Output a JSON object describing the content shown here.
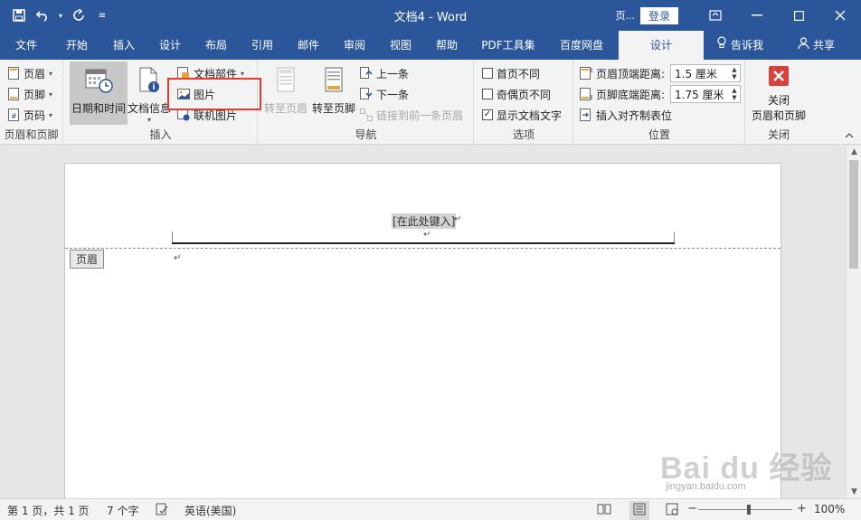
{
  "titlebar": {
    "title": "文档4 - Word",
    "tag": "页...",
    "login_label": "登录"
  },
  "tabs": [
    {
      "label": "文件"
    },
    {
      "label": "开始"
    },
    {
      "label": "插入"
    },
    {
      "label": "设计"
    },
    {
      "label": "布局"
    },
    {
      "label": "引用"
    },
    {
      "label": "邮件"
    },
    {
      "label": "审阅"
    },
    {
      "label": "视图"
    },
    {
      "label": "帮助"
    },
    {
      "label": "PDF工具集"
    },
    {
      "label": "百度网盘"
    },
    {
      "label": "设计"
    }
  ],
  "tell_me": "告诉我",
  "share": "共享",
  "ribbon": {
    "hf_group": {
      "label": "页眉和页脚",
      "header": "页眉",
      "footer": "页脚",
      "page_number": "页码"
    },
    "insert_group": {
      "label": "插入",
      "date_time": "日期和时间",
      "doc_info": "文档信息",
      "quick_parts": "文档部件",
      "pictures": "图片",
      "online_pictures": "联机图片"
    },
    "nav_group": {
      "label": "导航",
      "goto_header": "转至页眉",
      "goto_footer": "转至页脚",
      "previous": "上一条",
      "next": "下一条",
      "link_previous": "链接到前一条页眉"
    },
    "options_group": {
      "label": "选项",
      "different_first": "首页不同",
      "different_odd_even": "奇偶页不同",
      "show_doc_text": "显示文档文字",
      "show_doc_text_checked": "✓"
    },
    "position_group": {
      "label": "位置",
      "header_from_top": "页眉顶端距离:",
      "header_from_top_value": "1.5 厘米",
      "footer_from_bottom": "页脚底端距离:",
      "footer_from_bottom_value": "1.75 厘米",
      "insert_align_tab": "插入对齐制表位"
    },
    "close_group": {
      "label": "关闭",
      "close_line1": "关闭",
      "close_line2": "页眉和页脚"
    }
  },
  "document": {
    "header_placeholder": "[在此处键入]",
    "header_tag": "页眉",
    "pilcrow": "↵"
  },
  "statusbar": {
    "page": "第 1 页，共 1 页",
    "words": "7 个字",
    "language": "英语(美国)",
    "zoom": "100%"
  },
  "watermark": {
    "main": "Bai du 经验",
    "sub": "jingyan.baidu.com"
  },
  "colors": {
    "brand": "#2b579a",
    "highlight": "#e03c31"
  }
}
